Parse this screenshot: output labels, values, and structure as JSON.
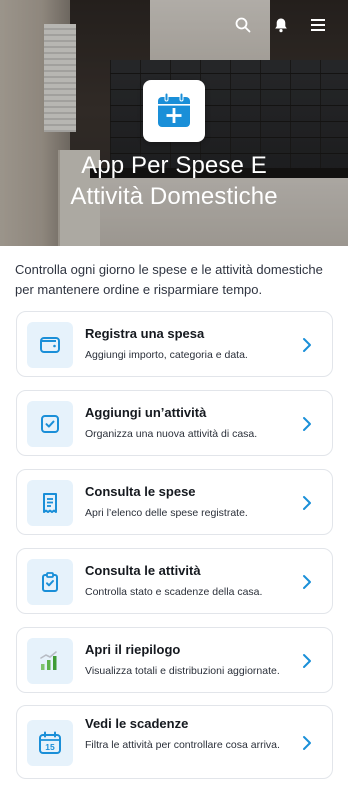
{
  "hero": {
    "title_line1": "App Per Spese E",
    "title_line2": "Attività Domestiche",
    "icon": "calendar-plus-icon"
  },
  "topbar": {
    "search_icon": "search-icon",
    "notify_icon": "bell-icon",
    "menu_icon": "hamburger-menu-icon"
  },
  "intro": "Controlla ogni giorno le spese e le attività domestiche per mantenere ordine e risparmiare tempo.",
  "accent": "#1a8fd8",
  "cards": [
    {
      "title": "Registra una spesa",
      "desc": "Aggiungi importo, categoria e data.",
      "icon": "wallet-icon"
    },
    {
      "title": "Aggiungi un’attività",
      "desc": "Organizza una nuova attività di casa.",
      "icon": "checkbox-icon"
    },
    {
      "title": "Consulta le spese",
      "desc": "Apri l’elenco delle spese registrate.",
      "icon": "receipt-icon"
    },
    {
      "title": "Consulta le attività",
      "desc": "Controlla stato e scadenze della casa.",
      "icon": "clipboard-check-icon"
    },
    {
      "title": "Apri il riepilogo",
      "desc": "Visualizza totali e distribuzioni aggiornate.",
      "icon": "bar-chart-icon"
    },
    {
      "title": "Vedi le scadenze",
      "desc": "Filtra le attività per controllare cosa arriva.",
      "icon": "calendar-15-icon",
      "icon_text": "15"
    }
  ]
}
